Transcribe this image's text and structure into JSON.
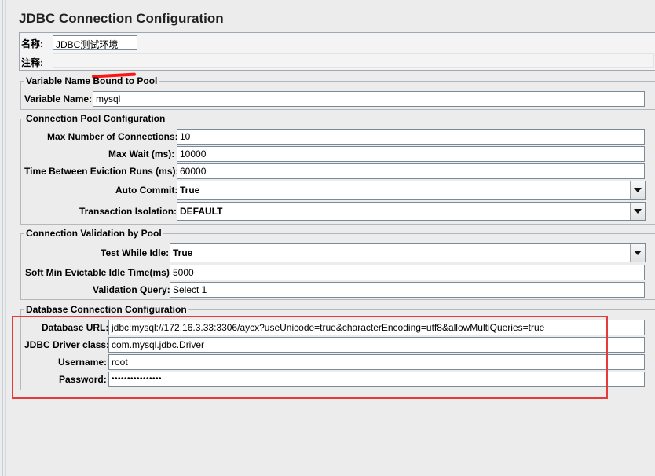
{
  "title": "JDBC Connection Configuration",
  "name_section": {
    "name_label": "名称:",
    "name_value": "JDBC测试环境",
    "comment_label": "注释:",
    "comment_value": ""
  },
  "variable_pool": {
    "legend": "Variable Name Bound to Pool",
    "variable_name_label": "Variable Name:",
    "variable_name_value": "mysql"
  },
  "pool_config": {
    "legend": "Connection Pool Configuration",
    "max_connections_label": "Max Number of Connections:",
    "max_connections_value": "10",
    "max_wait_label": "Max Wait (ms):",
    "max_wait_value": "10000",
    "eviction_label": "Time Between Eviction Runs (ms):",
    "eviction_value": "60000",
    "auto_commit_label": "Auto Commit:",
    "auto_commit_value": "True",
    "isolation_label": "Transaction Isolation:",
    "isolation_value": "DEFAULT"
  },
  "validation": {
    "legend": "Connection Validation by Pool",
    "test_idle_label": "Test While Idle:",
    "test_idle_value": "True",
    "soft_min_label": "Soft Min Evictable Idle Time(ms):",
    "soft_min_value": "5000",
    "query_label": "Validation Query:",
    "query_value": "Select 1"
  },
  "database": {
    "legend": "Database Connection Configuration",
    "url_label": "Database URL:",
    "url_value": "jdbc:mysql://172.16.3.33:3306/aycx?useUnicode=true&characterEncoding=utf8&allowMultiQueries=true",
    "driver_label": "JDBC Driver class:",
    "driver_value": "com.mysql.jdbc.Driver",
    "username_label": "Username:",
    "username_value": "root",
    "password_label": "Password:",
    "password_value": "••••••••••••••••"
  },
  "colors": {
    "background": "#ececec",
    "field_background": "#ffffff",
    "highlight": "#e53b3b",
    "redaction": "#ff1414"
  },
  "icons": {
    "dropdown": "chevron-down-icon"
  }
}
